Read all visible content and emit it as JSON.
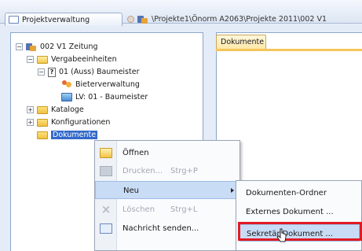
{
  "tabs": {
    "project_tab": "Projektverwaltung",
    "path_tab": "\\Projekte1\\Önorm A2063\\Projekte 2011\\002 V1"
  },
  "tree": {
    "root": "002 V1 Zeitung",
    "vergabe": "Vergabeeinheiten",
    "baumeister": "01 (Auss) Baumeister",
    "doc_icon_letter": "?",
    "bieter": "Bieterverwaltung",
    "lv": "LV: 01 - Baumeister",
    "kataloge": "Kataloge",
    "konfig": "Konfigurationen",
    "dokumente": "Dokumente",
    "expander_minus": "−",
    "expander_plus": "+"
  },
  "doc_pane": {
    "tab_label": "Dokumente"
  },
  "context_menu": {
    "open": "Öffnen",
    "print": "Drucken...",
    "print_shortcut": "Strg+P",
    "new": "Neu",
    "delete": "Löschen",
    "delete_shortcut": "Strg+L",
    "send_msg": "Nachricht senden..."
  },
  "submenu": {
    "folder": "Dokumenten-Ordner",
    "external": "Externes Dokument ...",
    "secretary": "Sekretär-Dokument ..."
  },
  "colors": {
    "selection": "#3369c9",
    "highlight": "#c9dcf5",
    "callout": "#e01b24"
  }
}
